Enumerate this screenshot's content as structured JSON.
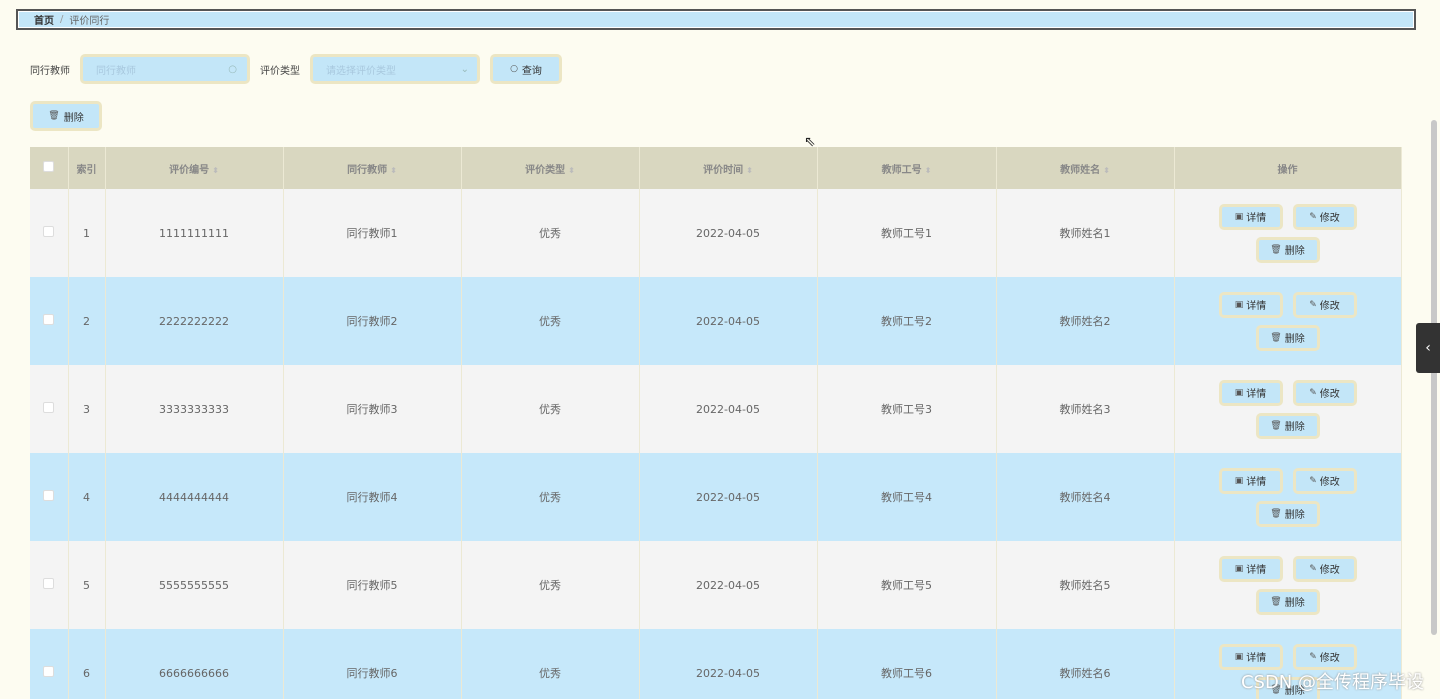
{
  "breadcrumb": {
    "home": "首页",
    "separator": "/",
    "current": "评价同行"
  },
  "filters": {
    "teacher_label": "同行教师",
    "teacher_placeholder": "同行教师",
    "type_label": "评价类型",
    "type_placeholder": "请选择评价类型",
    "query_label": "查询",
    "delete_label": "删除"
  },
  "table": {
    "headers": {
      "index": "索引",
      "code": "评价编号",
      "teacher": "同行教师",
      "type": "评价类型",
      "time": "评价时间",
      "job_no": "教师工号",
      "name": "教师姓名",
      "actions": "操作"
    },
    "rows": [
      {
        "index": "1",
        "code": "1111111111",
        "teacher": "同行教师1",
        "type": "优秀",
        "time": "2022-04-05",
        "job_no": "教师工号1",
        "name": "教师姓名1"
      },
      {
        "index": "2",
        "code": "2222222222",
        "teacher": "同行教师2",
        "type": "优秀",
        "time": "2022-04-05",
        "job_no": "教师工号2",
        "name": "教师姓名2"
      },
      {
        "index": "3",
        "code": "3333333333",
        "teacher": "同行教师3",
        "type": "优秀",
        "time": "2022-04-05",
        "job_no": "教师工号3",
        "name": "教师姓名3"
      },
      {
        "index": "4",
        "code": "4444444444",
        "teacher": "同行教师4",
        "type": "优秀",
        "time": "2022-04-05",
        "job_no": "教师工号4",
        "name": "教师姓名4"
      },
      {
        "index": "5",
        "code": "5555555555",
        "teacher": "同行教师5",
        "type": "优秀",
        "time": "2022-04-05",
        "job_no": "教师工号5",
        "name": "教师姓名5"
      },
      {
        "index": "6",
        "code": "6666666666",
        "teacher": "同行教师6",
        "type": "优秀",
        "time": "2022-04-05",
        "job_no": "教师工号6",
        "name": "教师姓名6"
      }
    ],
    "actions": {
      "detail": "详情",
      "edit": "修改",
      "delete": "删除"
    }
  },
  "watermark": "CSDN @全传程序毕设",
  "icons": {
    "search": "search-icon",
    "chevron": "chevron-down-icon",
    "delete": "trash-icon",
    "detail": "document-icon",
    "edit": "pencil-icon",
    "collapse": "chevron-left-icon"
  },
  "colors": {
    "background": "#fdfcf1",
    "button": "#c3e6f8",
    "header": "#d9d7c0",
    "row_alt": "#c6e8fa"
  }
}
